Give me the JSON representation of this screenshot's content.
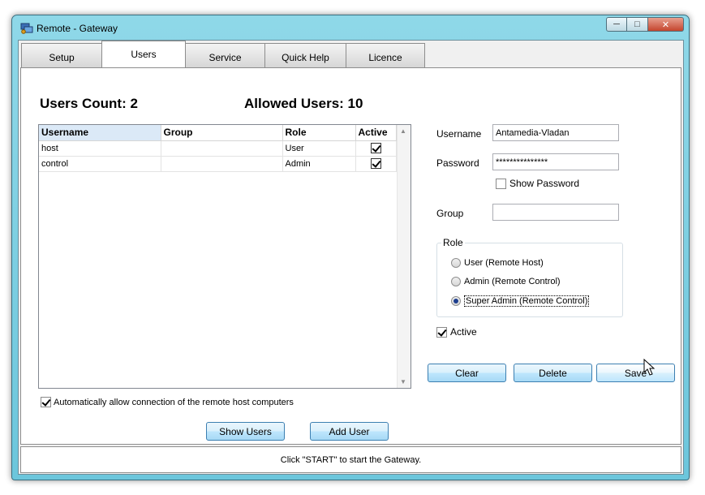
{
  "window": {
    "title": "Remote - Gateway"
  },
  "tabs": [
    {
      "label": "Setup",
      "active": false
    },
    {
      "label": "Users",
      "active": true
    },
    {
      "label": "Service",
      "active": false
    },
    {
      "label": "Quick Help",
      "active": false
    },
    {
      "label": "Licence",
      "active": false
    }
  ],
  "counts": {
    "users_count_label": "Users Count:",
    "users_count_value": "2",
    "allowed_users_label": "Allowed Users:",
    "allowed_users_value": "10"
  },
  "users_table": {
    "columns": [
      "Username",
      "Group",
      "Role",
      "Active"
    ],
    "rows": [
      {
        "username": "host",
        "group": "",
        "role": "User",
        "active": true
      },
      {
        "username": "control",
        "group": "",
        "role": "Admin",
        "active": true
      }
    ]
  },
  "form": {
    "username_label": "Username",
    "username_value": "Antamedia-Vladan",
    "password_label": "Password",
    "password_value": "***************",
    "show_password_label": "Show Password",
    "show_password_checked": false,
    "group_label": "Group",
    "group_value": "",
    "role_title": "Role",
    "role_options": [
      {
        "label": "User (Remote Host)",
        "selected": false
      },
      {
        "label": "Admin (Remote Control)",
        "selected": false
      },
      {
        "label": "Super Admin (Remote Control)",
        "selected": true
      }
    ],
    "active_label": "Active",
    "active_checked": true
  },
  "buttons": {
    "clear": "Clear",
    "delete": "Delete",
    "save": "Save",
    "show_users": "Show Users",
    "add_user": "Add User"
  },
  "auto_allow": {
    "label": "Automatically allow connection of the remote host computers",
    "checked": true
  },
  "status": {
    "text": "Click \"START\" to start the Gateway."
  },
  "icons": {
    "app": "gateway-app-icon",
    "minimize": "minimize-icon",
    "maximize": "maximize-icon",
    "close": "close-icon",
    "cursor": "mouse-pointer-icon"
  }
}
